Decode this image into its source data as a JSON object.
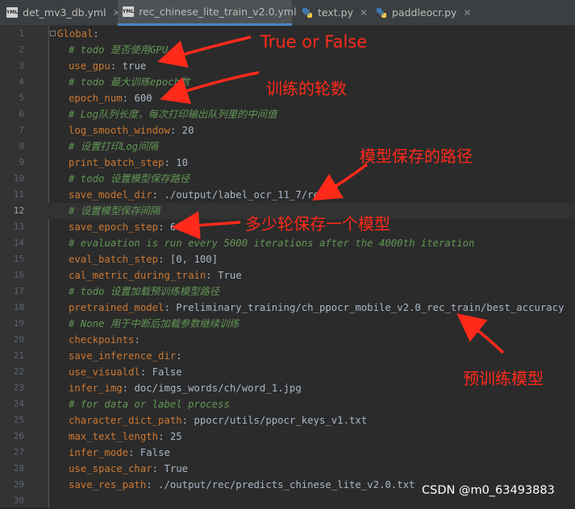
{
  "tabs": [
    {
      "label": "det_mv3_db.yml",
      "type": "yml",
      "active": false
    },
    {
      "label": "rec_chinese_lite_train_v2.0.yml",
      "type": "yml",
      "active": true
    },
    {
      "label": "text.py",
      "type": "py",
      "active": false
    },
    {
      "label": "paddleocr.py",
      "type": "py",
      "active": false
    }
  ],
  "editor": {
    "current_line": 12,
    "lines": [
      {
        "n": "1",
        "indent": 0,
        "key": "Global",
        "value": ""
      },
      {
        "n": "2",
        "indent": 1,
        "comment": "# todo 是否使用GPU"
      },
      {
        "n": "3",
        "indent": 1,
        "key": "use_gpu",
        "value": " true"
      },
      {
        "n": "4",
        "indent": 1,
        "comment": "# todo 最大训练epoch数"
      },
      {
        "n": "5",
        "indent": 1,
        "key": "epoch_num",
        "value": " 600"
      },
      {
        "n": "6",
        "indent": 1,
        "comment": "# Log队列长度，每次打印输出队列里的中间值"
      },
      {
        "n": "7",
        "indent": 1,
        "key": "log_smooth_window",
        "value": " 20"
      },
      {
        "n": "8",
        "indent": 1,
        "comment": "# 设置打印Log间隔"
      },
      {
        "n": "9",
        "indent": 1,
        "key": "print_batch_step",
        "value": " 10"
      },
      {
        "n": "10",
        "indent": 1,
        "comment": "# todo 设置模型保存路径"
      },
      {
        "n": "11",
        "indent": 1,
        "key": "save_model_dir",
        "value": " ./output/label_ocr_11_7/rec/"
      },
      {
        "n": "12",
        "indent": 1,
        "comment": "# 设置模型保存间隔"
      },
      {
        "n": "13",
        "indent": 1,
        "key": "save_epoch_step",
        "value": " 60"
      },
      {
        "n": "14",
        "indent": 1,
        "comment": "# evaluation is run every 5000 iterations after the 4000th iteration"
      },
      {
        "n": "15",
        "indent": 1,
        "key": "eval_batch_step",
        "value": " [0, 100]"
      },
      {
        "n": "16",
        "indent": 1,
        "key": "cal_metric_during_train",
        "value": " True"
      },
      {
        "n": "17",
        "indent": 1,
        "comment": "# todo 设置加载预训练模型路径"
      },
      {
        "n": "18",
        "indent": 1,
        "key": "pretrained_model",
        "value": " Preliminary_training/ch_ppocr_mobile_v2.0_rec_train/best_accuracy"
      },
      {
        "n": "19",
        "indent": 1,
        "comment": "# None 用于中断后加载参数继续训练"
      },
      {
        "n": "20",
        "indent": 1,
        "key": "checkpoints",
        "value": ""
      },
      {
        "n": "21",
        "indent": 1,
        "key": "save_inference_dir",
        "value": ""
      },
      {
        "n": "22",
        "indent": 1,
        "key": "use_visualdl",
        "value": " False"
      },
      {
        "n": "23",
        "indent": 1,
        "key": "infer_img",
        "value": " doc/imgs_words/ch/word_1.jpg"
      },
      {
        "n": "24",
        "indent": 1,
        "comment": "# for data or label process"
      },
      {
        "n": "25",
        "indent": 1,
        "key": "character_dict_path",
        "value": " ppocr/utils/ppocr_keys_v1.txt"
      },
      {
        "n": "26",
        "indent": 1,
        "key": "max_text_length",
        "value": " 25"
      },
      {
        "n": "27",
        "indent": 1,
        "key": "infer_mode",
        "value": " False"
      },
      {
        "n": "28",
        "indent": 1,
        "key": "use_space_char",
        "value": " True"
      },
      {
        "n": "29",
        "indent": 1,
        "key": "save_res_path",
        "value": " ./output/rec/predicts_chinese_lite_v2.0.txt"
      },
      {
        "n": "30",
        "indent": 0,
        "key": "",
        "value": ""
      }
    ]
  },
  "annotations": {
    "a1": "True or False",
    "a2": "训练的轮数",
    "a3": "模型保存的路径",
    "a4": "多少轮保存一个模型",
    "a5": "预训练模型"
  },
  "watermark": "CSDN @m0_63493883",
  "colors": {
    "annotation": "#ff2a1a",
    "key": "#cc7832",
    "comment": "#629755",
    "text": "#a9b7c6",
    "background": "#2b2b2b"
  }
}
